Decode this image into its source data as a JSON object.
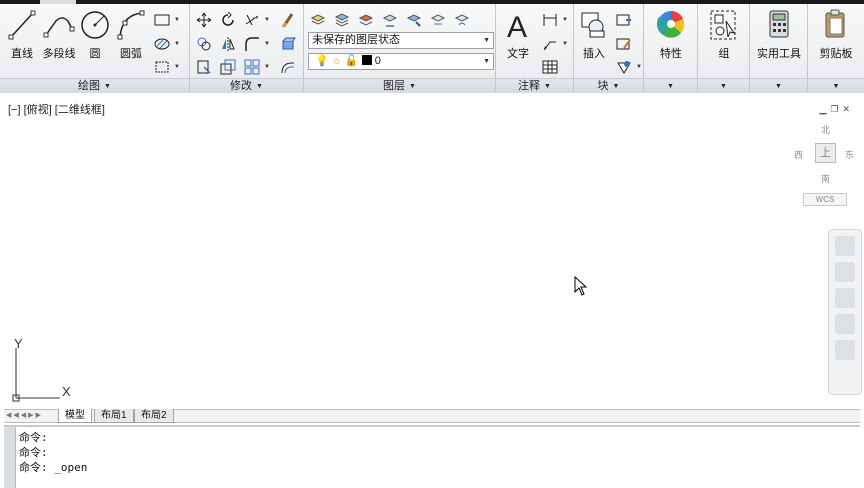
{
  "ribbon": {
    "draw": {
      "title": "绘图",
      "line": "直线",
      "polyline": "多段线",
      "circle": "圆",
      "arc": "圆弧"
    },
    "modify": {
      "title": "修改"
    },
    "layers": {
      "title": "图层",
      "layer_state": "未保存的图层状态",
      "current_layer": "0"
    },
    "annotation": {
      "title": "注释",
      "text": "文字"
    },
    "block": {
      "title": "块",
      "insert": "插入"
    },
    "properties": {
      "label": "特性"
    },
    "groups": {
      "label": "组"
    },
    "utilities": {
      "label": "实用工具"
    },
    "clipboard": {
      "label": "剪贴板"
    }
  },
  "viewport": {
    "label": "[−] [俯视] [二维线框]",
    "viewcube": {
      "north": "北",
      "south": "南",
      "east": "东",
      "west": "西",
      "face": "上"
    },
    "wcs": "WCS",
    "ucs_x": "X",
    "ucs_y": "Y"
  },
  "layout_tabs": [
    "模型",
    "布局1",
    "布局2"
  ],
  "command_history": [
    "命令:",
    "命令:",
    "命令: _open"
  ]
}
